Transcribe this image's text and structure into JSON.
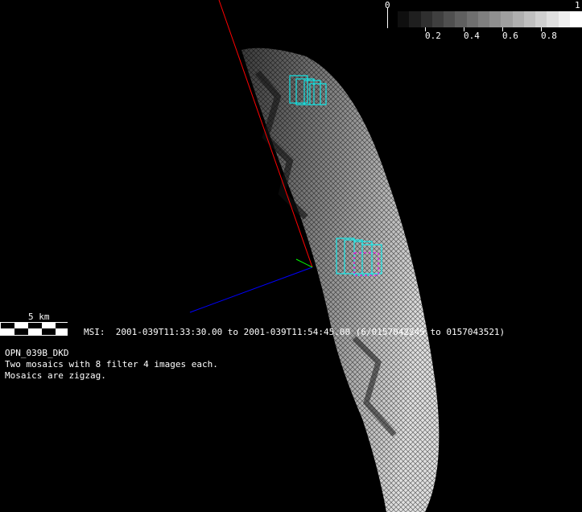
{
  "colorbar": {
    "min_label": "0",
    "max_label": "1",
    "tick_labels": [
      "0.2",
      "0.4",
      "0.6",
      "0.8"
    ],
    "steps": 16
  },
  "scale_bar": {
    "label": "5 km"
  },
  "instrument_line": "MSI:  2001-039T11:33:30.00 to 2001-039T11:54:45.00 (6/0157042245 to 0157043521)",
  "notes": {
    "title": "OPN_039B_DKD",
    "line1": "Two mosaics with 8 filter 4 images each.",
    "line2": "Mosaics are zigzag."
  },
  "colors": {
    "x_axis": "#ff0000",
    "y_axis": "#00ff00",
    "z_axis": "#0000ff",
    "footprint": "#00ffff",
    "highlight": "#ff00ff"
  }
}
